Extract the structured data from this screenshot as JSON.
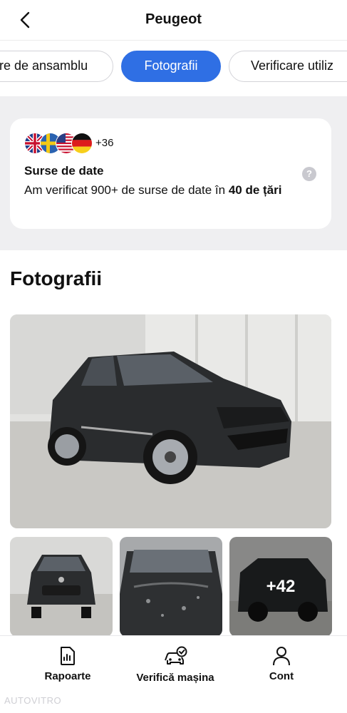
{
  "header": {
    "title": "Peugeot"
  },
  "tabs": [
    {
      "label": "re de ansamblu"
    },
    {
      "label": "Fotografii"
    },
    {
      "label": "Verificare utiliz"
    }
  ],
  "progress": {
    "fraction": 0.065
  },
  "sources_card": {
    "extra_count": "+36",
    "title": "Surse de date",
    "desc_prefix": "Am verificat 900+ de surse de date în ",
    "desc_bold": "40 de țări",
    "help": "?",
    "flags": [
      "uk-flag-icon",
      "sweden-flag-icon",
      "usa-flag-icon",
      "germany-flag-icon"
    ]
  },
  "photos": {
    "title": "Fotografii",
    "more_count": "+42"
  },
  "bottom_nav": [
    {
      "label": "Rapoarte",
      "icon": "report-icon"
    },
    {
      "label": "Verifică mașina",
      "icon": "car-check-icon"
    },
    {
      "label": "Cont",
      "icon": "user-icon"
    }
  ],
  "watermark": "AUTOVITRO",
  "colors": {
    "accent": "#2f6fe4",
    "page_bg": "#efeff1"
  }
}
